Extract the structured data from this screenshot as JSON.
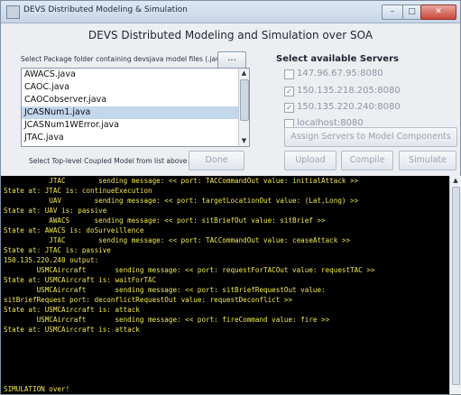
{
  "window": {
    "title": "DEVS Distributed Modeling & Simulation",
    "minimize_glyph": "–",
    "maximize_glyph": "□",
    "close_glyph": "✕"
  },
  "heading": "DEVS Distributed Modeling and Simulation over SOA",
  "package": {
    "label": "Select Package folder containing devsjava model files (.java)",
    "browse_label": "...",
    "files": [
      "AWACS.java",
      "CAOC.java",
      "CAOCobserver.java",
      "JCASNum1.java",
      "JCASNum1WError.java",
      "JTAC.java"
    ],
    "selected_index": 3
  },
  "coupled_label": "Select Top-level Coupled Model from list above",
  "buttons": {
    "done": "Done",
    "upload": "Upload",
    "compile": "Compile",
    "simulate": "Simulate",
    "assign": "Assign Servers to Model Components"
  },
  "servers": {
    "label": "Select available Servers",
    "items": [
      {
        "label": "147.96.67.95:8080",
        "checked": false
      },
      {
        "label": "150.135.218.205:8080",
        "checked": true
      },
      {
        "label": "150.135.220.240:8080",
        "checked": true
      },
      {
        "label": "localhost:8080",
        "checked": false
      }
    ]
  },
  "console": {
    "lines": [
      "           JTAC        sending message: << port: TACCommandOut value: initialAttack >>",
      "State at: JTAC is: continueExecution",
      "           UAV        sending message: << port: targetLocationOut value: (Lat,Long) >>",
      "State at: UAV is: passive",
      "           AWACS      sending message: << port: sitBriefOut value: sitBrief >>",
      "State at: AWACS is: doSurveillence",
      "           JTAC        sending message: << port: TACCommandOut value: ceaseAttack >>",
      "State at: JTAC is: passive",
      "150.135.220.240 output:",
      "        USMCAircraft       sending message: << port: requestForTACOut value: requestTAC >>",
      "State at: USMCAircraft is: waitForTAC",
      "        USMCAircraft       sending message: << port: sitBriefRequestOut value:",
      "sitBriefRequest port: deconflictRequestOut value: requestDeconflict >>",
      "State at: USMCAircraft is: attack",
      "        USMCAircraft       sending message: << port: fireCommand value: fire >>",
      "State at: USMCAircraft is: attack",
      "",
      "SIMULATION over!"
    ]
  }
}
